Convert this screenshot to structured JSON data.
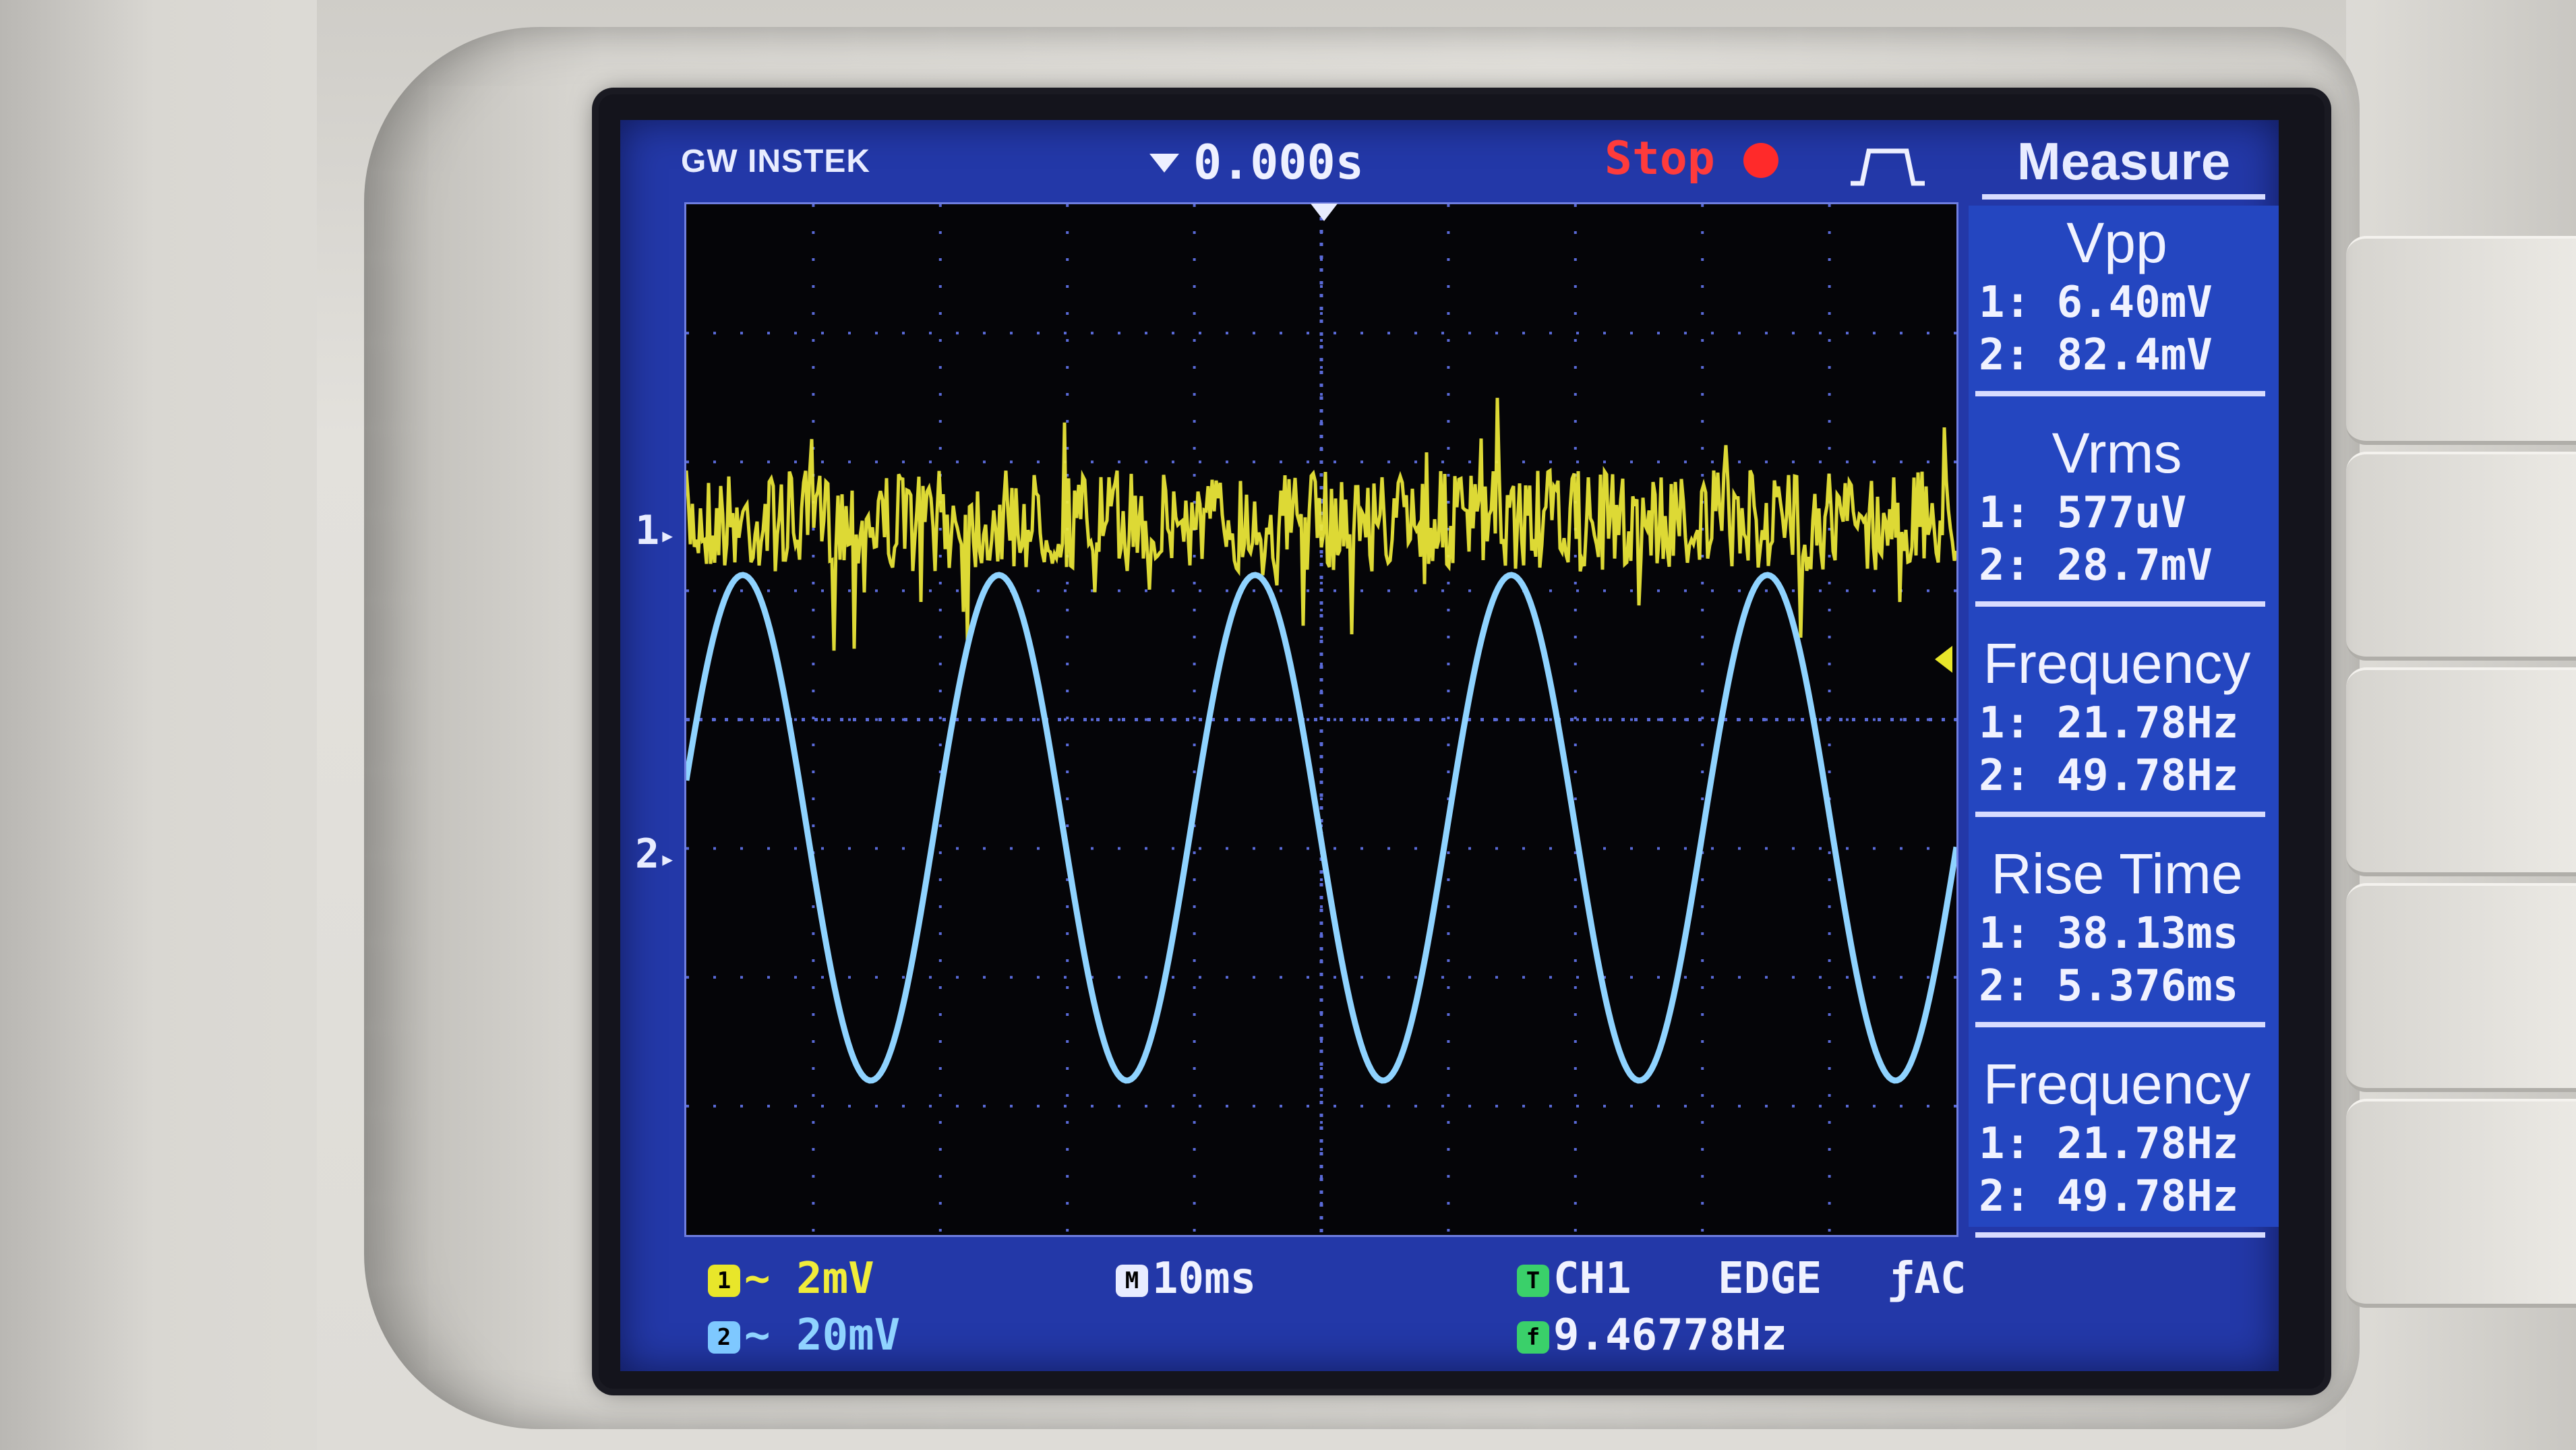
{
  "header": {
    "brand": "GW INSTEK",
    "trigger_time": "0.000s",
    "status": "Stop",
    "measure_title": "Measure"
  },
  "channels": [
    {
      "id": "1",
      "marker_label": "1",
      "color": "#e8e62a",
      "coupling_icon": "ac-coupling-icon",
      "scale": "2mV"
    },
    {
      "id": "2",
      "marker_label": "2",
      "color": "#7ec8ff",
      "coupling_icon": "ac-coupling-icon",
      "scale": "20mV"
    }
  ],
  "measurements": [
    {
      "title": "Vpp",
      "ch1": "1: 6.40mV",
      "ch2": "2: 82.4mV"
    },
    {
      "title": "Vrms",
      "ch1": "1: 577uV",
      "ch2": "2: 28.7mV"
    },
    {
      "title": "Frequency",
      "ch1": "1: 21.78Hz",
      "ch2": "2: 49.78Hz"
    },
    {
      "title": "Rise Time",
      "ch1": "1: 38.13ms",
      "ch2": "2: 5.376ms"
    },
    {
      "title": "Frequency",
      "ch1": "1: 21.78Hz",
      "ch2": "2: 49.78Hz"
    }
  ],
  "footer": {
    "ch1_scale": "~ 2mV",
    "ch2_scale": "~ 20mV",
    "timebase": "10ms",
    "trigger_source": "CH1",
    "trigger_type": "EDGE",
    "trigger_coupling": "AC",
    "trigger_freq": "9.46778Hz"
  },
  "colors": {
    "ch1_trace": "#f0ec3a",
    "ch2_trace": "#8fd3ff",
    "lcd_bg": "#2338a8",
    "grid": "#5a6ad8"
  }
}
